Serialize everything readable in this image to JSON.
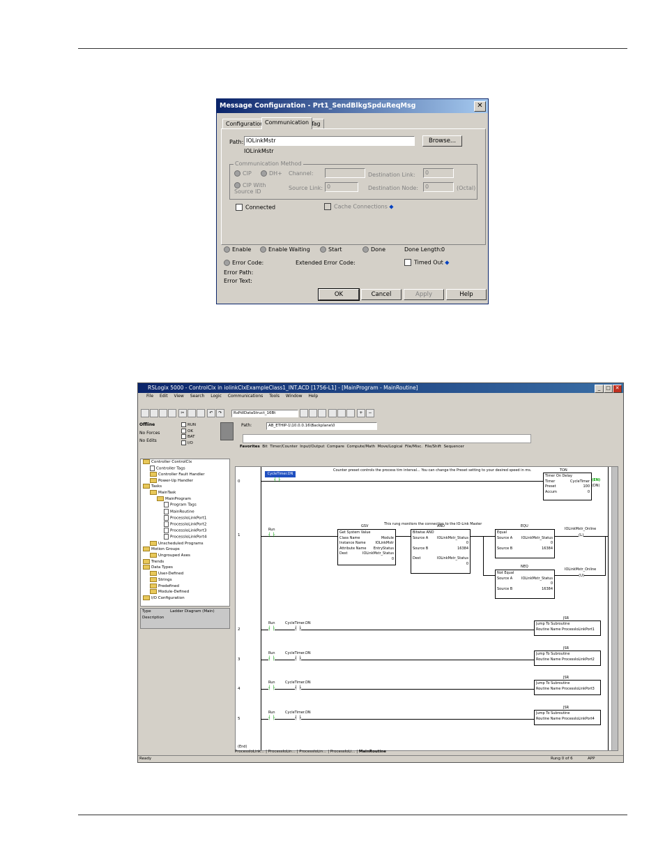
{
  "dialog": {
    "title": "Message Configuration - Prt1_SendBlkgSpduReqMsg",
    "tabs": [
      "Configuration",
      "Communication",
      "Tag"
    ],
    "path_label": "Path:",
    "path_value": "IOLinkMstr",
    "path_resolved": "IOLinkMstr",
    "browse_label": "Browse...",
    "comm_method_label": "Communication Method",
    "cip_label": "CIP",
    "dhplus_label": "DH+",
    "channel_label": "Channel:",
    "dest_link_label": "Destination Link:",
    "dest_link_value": "0",
    "cip_source_label": "CIP With Source ID",
    "source_link_label": "Source Link:",
    "source_link_value": "0",
    "dest_node_label": "Destination Node:",
    "dest_node_value": "0",
    "octal_label": "(Octal)",
    "connected_label": "Connected",
    "cache_label": "Cache Connections",
    "enable_label": "Enable",
    "enable_waiting_label": "Enable Waiting",
    "start_label": "Start",
    "done_label": "Done",
    "done_length_label": "Done Length:",
    "done_length_value": "0",
    "error_code_label": "Error Code:",
    "extended_error_label": "Extended Error Code:",
    "timed_out_label": "Timed Out",
    "error_path_label": "Error Path:",
    "error_text_label": "Error Text:",
    "ok_label": "OK",
    "cancel_label": "Cancel",
    "apply_label": "Apply",
    "help_label": "Help"
  },
  "rslogix": {
    "title": "RSLogix 5000 - ControlClx in iolinkClxExampleClass1_INT.ACD [1756-L1] - [MainProgram - MainRoutine]",
    "menu": [
      "File",
      "Edit",
      "View",
      "Search",
      "Logic",
      "Communications",
      "Tools",
      "Window",
      "Help"
    ],
    "tag_combo": "RsPdlDataStruct_16Bt",
    "path_label": "Path:",
    "path_value": "AB_ETHIP-1\\10.0.0.16\\Backplane\\0",
    "status_offline": "Offline",
    "status_forces": "No Forces",
    "status_edits": "No Edits",
    "led_labels": [
      "RUN",
      "OK",
      "BAT",
      "I/O"
    ],
    "instr_tabs": [
      "Favorites",
      "Bit",
      "Timer/Counter",
      "Input/Output",
      "Compare",
      "Compute/Math",
      "Move/Logical",
      "File/Misc.",
      "File/Shift",
      "Sequencer"
    ],
    "tree": [
      {
        "label": "Controller ControlClx",
        "indent": 0,
        "kind": "folder"
      },
      {
        "label": "Controller Tags",
        "indent": 1,
        "kind": "doc"
      },
      {
        "label": "Controller Fault Handler",
        "indent": 1,
        "kind": "folder"
      },
      {
        "label": "Power-Up Handler",
        "indent": 1,
        "kind": "folder"
      },
      {
        "label": "Tasks",
        "indent": 0,
        "kind": "folder"
      },
      {
        "label": "MainTask",
        "indent": 1,
        "kind": "folder"
      },
      {
        "label": "MainProgram",
        "indent": 2,
        "kind": "folder"
      },
      {
        "label": "Program Tags",
        "indent": 3,
        "kind": "doc"
      },
      {
        "label": "MainRoutine",
        "indent": 3,
        "kind": "doc"
      },
      {
        "label": "ProcessIoLinkPort1",
        "indent": 3,
        "kind": "doc"
      },
      {
        "label": "ProcessIoLinkPort2",
        "indent": 3,
        "kind": "doc"
      },
      {
        "label": "ProcessIoLinkPort3",
        "indent": 3,
        "kind": "doc"
      },
      {
        "label": "ProcessIoLinkPort4",
        "indent": 3,
        "kind": "doc"
      },
      {
        "label": "Unscheduled Programs",
        "indent": 1,
        "kind": "folder"
      },
      {
        "label": "Motion Groups",
        "indent": 0,
        "kind": "folder"
      },
      {
        "label": "Ungrouped Axes",
        "indent": 1,
        "kind": "folder"
      },
      {
        "label": "Trends",
        "indent": 0,
        "kind": "folder"
      },
      {
        "label": "Data Types",
        "indent": 0,
        "kind": "folder"
      },
      {
        "label": "User-Defined",
        "indent": 1,
        "kind": "folder"
      },
      {
        "label": "Strings",
        "indent": 1,
        "kind": "folder"
      },
      {
        "label": "Predefined",
        "indent": 1,
        "kind": "folder"
      },
      {
        "label": "Module-Defined",
        "indent": 1,
        "kind": "folder"
      },
      {
        "label": "I/O Configuration",
        "indent": 0,
        "kind": "folder"
      }
    ],
    "props": {
      "type_label": "Type",
      "type_value": "Ladder Diagram (Main)",
      "desc_label": "Description"
    },
    "rungs": {
      "r0": {
        "num": "0",
        "contact": "CycleTimer.DN",
        "comment": "Counter preset controls the process tim interval... You can change the Preset setting to your desired speed in ms.",
        "ton_hdr": "TON",
        "ton_title": "Timer On Delay",
        "timer_label": "Timer",
        "timer_value": "CycleTimer",
        "preset_label": "Preset",
        "preset_value": "100",
        "accum_label": "Accum",
        "accum_value": "0",
        "en": "EN",
        "dn": "DN"
      },
      "r1": {
        "num": "1",
        "contact": "Run",
        "comment": "This rung monitors the connection to the IO-Link Master",
        "gsv_hdr": "GSV",
        "gsv_title": "Get System Value",
        "class_label": "Class Name",
        "class_value": "Module",
        "inst_label": "Instance Name",
        "inst_value": "IOLinkMstr",
        "attr_label": "Attribute Name",
        "attr_value": "EntryStatus",
        "dest_label": "Dest",
        "dest_value": "IOLinkMstr_Status",
        "dest_num": "0",
        "and_hdr": "AND",
        "and_title": "Bitwise AND",
        "srca_label": "Source A",
        "srca_value": "IOLinkMstr_Status",
        "srca_num": "0",
        "srcb_label": "Source B",
        "srcb_value": "16384",
        "and_dest_label": "Dest",
        "and_dest_value": "IOLinkMstr_Status",
        "and_dest_num": "0",
        "equ_hdr": "EQU",
        "equ_title": "Equal",
        "equ_srca_label": "Source A",
        "equ_srca_value": "IOLinkMstr_Status",
        "equ_srca_num": "0",
        "equ_srcb_label": "Source B",
        "equ_srcb_value": "16384",
        "neq_hdr": "NEQ",
        "neq_title": "Not Equal",
        "neq_srca_label": "Source A",
        "neq_srca_value": "IOLinkMstr_Status",
        "neq_srca_num": "0",
        "neq_srcb_label": "Source B",
        "neq_srcb_value": "16384",
        "coil_tag": "IOLinkMstr_Online",
        "coil_l": "(L)",
        "coil_u": "(U)"
      },
      "jsr": [
        {
          "num": "2",
          "run": "Run",
          "dn": "CycleTimer.DN",
          "hdr": "JSR",
          "title": "Jump To Subroutine",
          "routine_label": "Routine Name",
          "routine_value": "ProcessIoLinkPort1"
        },
        {
          "num": "3",
          "run": "Run",
          "dn": "CycleTimer.DN",
          "hdr": "JSR",
          "title": "Jump To Subroutine",
          "routine_label": "Routine Name",
          "routine_value": "ProcessIoLinkPort2"
        },
        {
          "num": "4",
          "run": "Run",
          "dn": "CycleTimer.DN",
          "hdr": "JSR",
          "title": "Jump To Subroutine",
          "routine_label": "Routine Name",
          "routine_value": "ProcessIoLinkPort3"
        },
        {
          "num": "5",
          "run": "Run",
          "dn": "CycleTimer.DN",
          "hdr": "JSR",
          "title": "Jump To Subroutine",
          "routine_label": "Routine Name",
          "routine_value": "ProcessIoLinkPort4"
        }
      ],
      "end_label": "(End)"
    },
    "bottom_tabs": [
      "ProcessIoLink...",
      "ProcessIoLin...",
      "ProcessIoLin...",
      "ProcessIoLi...",
      "MainRoutine"
    ],
    "status_ready": "Ready",
    "status_rung": "Rung 0 of 6",
    "status_app": "APP"
  }
}
